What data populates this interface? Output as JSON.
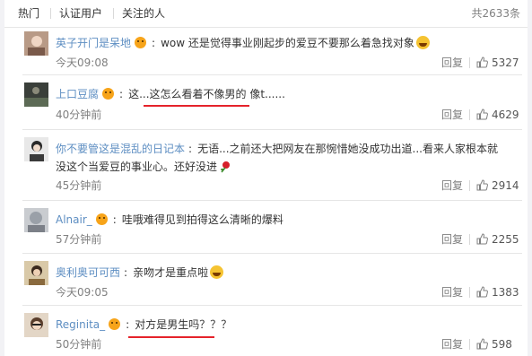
{
  "tabs": [
    "热门",
    "认证用户",
    "关注的人"
  ],
  "total": "共2633条",
  "reply_label": "回复",
  "icons": {
    "verified": "vip-badge-icon",
    "like": "thumbs-up-icon",
    "emoji": "laughing-emoji-icon",
    "rose": "rose-emoji-icon"
  },
  "colors": {
    "username": "#5d8ec2",
    "annotation": "#e5232b"
  },
  "comments": [
    {
      "user": "英子开门是呆地",
      "text": "wow 还是觉得事业刚起步的爱豆不要那么着急找对象",
      "time": "今天09:08",
      "likes": "5327"
    },
    {
      "user": "上口豆腐",
      "text": "这...这怎么看着不像男的 像t......",
      "time": "40分钟前",
      "likes": "4629"
    },
    {
      "user": "你不要管这是混乱的日记本",
      "text": "无语...之前还大把网友在那惋惜她没成功出道...看来人家根本就没这个当爱豆的事业心。还好没进",
      "time": "45分钟前",
      "likes": "2914"
    },
    {
      "user": "Alnair_",
      "text": "哇哦难得见到拍得这么清晰的爆料",
      "time": "57分钟前",
      "likes": "2255"
    },
    {
      "user": "奥利奥可可西",
      "text": "亲吻才是重点啦",
      "time": "今天09:05",
      "likes": "1383"
    },
    {
      "user": "Reginita_",
      "text": "对方是男生吗？？？",
      "time": "50分钟前",
      "likes": "598"
    }
  ]
}
